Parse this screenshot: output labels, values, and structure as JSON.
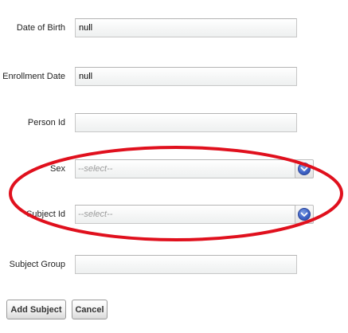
{
  "form": {
    "date_of_birth": {
      "label": "Date of Birth",
      "value": "null"
    },
    "enrollment_date": {
      "label": "Enrollment Date",
      "value": "null"
    },
    "person_id": {
      "label": "Person Id",
      "value": ""
    },
    "sex": {
      "label": "Sex",
      "placeholder": "--select--",
      "icon": "chevron-down-icon"
    },
    "subject_id": {
      "label": "Subject Id",
      "placeholder": "--select--",
      "icon": "chevron-down-icon"
    },
    "subject_group": {
      "label": "Subject Group",
      "value": ""
    }
  },
  "actions": {
    "add_subject": "Add Subject",
    "cancel": "Cancel"
  },
  "annotation": {
    "shape": "ellipse",
    "color": "#e0101d"
  },
  "colors": {
    "dropdown_accent": "#3f63c7",
    "field_border": "#c7c7c7"
  }
}
